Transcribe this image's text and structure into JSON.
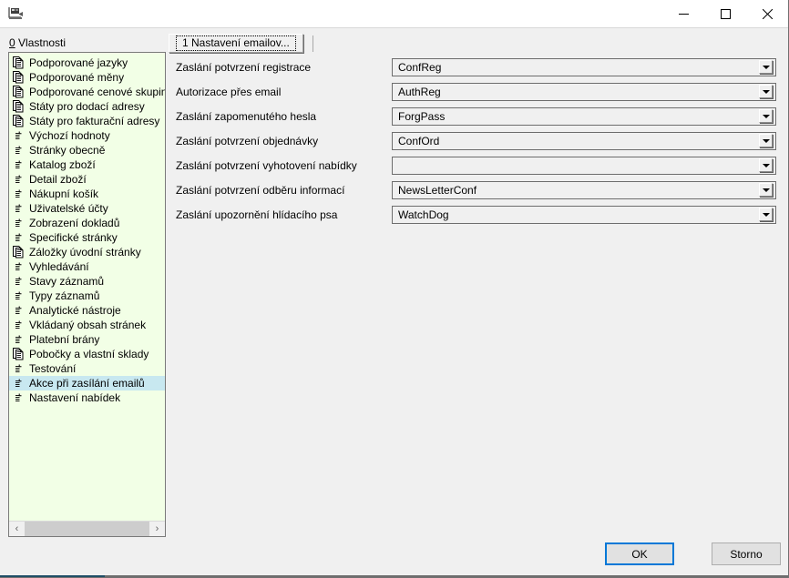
{
  "window": {
    "icon_name": "app-icon",
    "title": "",
    "controls": [
      {
        "name": "minimize-button",
        "glyph": "minimize-icon"
      },
      {
        "name": "maximize-button",
        "glyph": "maximize-icon"
      },
      {
        "name": "close-button",
        "glyph": "close-icon"
      }
    ]
  },
  "sidebar": {
    "label_accesskey": "0",
    "label_text": " Vlastnosti",
    "selected_index": 22,
    "items": [
      {
        "label": "Podporované jazyky",
        "icon": "multi-document-icon"
      },
      {
        "label": "Podporované měny",
        "icon": "multi-document-icon"
      },
      {
        "label": "Podporované cenové skupiny",
        "icon": "multi-document-icon"
      },
      {
        "label": "Státy pro dodací adresy",
        "icon": "multi-document-icon"
      },
      {
        "label": "Státy pro fakturační adresy",
        "icon": "multi-document-icon"
      },
      {
        "label": "Výchozí hodnoty",
        "icon": "document-icon"
      },
      {
        "label": "Stránky obecně",
        "icon": "document-icon"
      },
      {
        "label": "Katalog zboží",
        "icon": "document-icon"
      },
      {
        "label": "Detail zboží",
        "icon": "document-icon"
      },
      {
        "label": "Nákupní košík",
        "icon": "document-icon"
      },
      {
        "label": "Uživatelské účty",
        "icon": "document-icon"
      },
      {
        "label": "Zobrazení dokladů",
        "icon": "document-icon"
      },
      {
        "label": "Specifické stránky",
        "icon": "document-icon"
      },
      {
        "label": "Záložky úvodní stránky",
        "icon": "multi-document-icon"
      },
      {
        "label": "Vyhledávání",
        "icon": "document-icon"
      },
      {
        "label": "Stavy záznamů",
        "icon": "document-icon"
      },
      {
        "label": "Typy záznamů",
        "icon": "document-icon"
      },
      {
        "label": "Analytické nástroje",
        "icon": "document-icon"
      },
      {
        "label": "Vkládaný obsah stránek",
        "icon": "document-icon"
      },
      {
        "label": "Platební brány",
        "icon": "document-icon"
      },
      {
        "label": "Pobočky a vlastní sklady",
        "icon": "multi-document-icon"
      },
      {
        "label": "Testování",
        "icon": "document-icon"
      },
      {
        "label": "Akce při zasílání emailů",
        "icon": "document-icon"
      },
      {
        "label": "Nastavení nabídek",
        "icon": "document-icon"
      }
    ],
    "scrollbar": {
      "left_arrow": "‹",
      "right_arrow": "›"
    }
  },
  "tabs": [
    {
      "label": "1 Nastavení emailov...",
      "active": true
    }
  ],
  "form": {
    "rows": [
      {
        "label": "Zaslání potvrzení registrace",
        "value": "ConfReg"
      },
      {
        "label": "Autorizace přes email",
        "value": "AuthReg"
      },
      {
        "label": "Zaslání zapomenutého hesla",
        "value": "ForgPass"
      },
      {
        "label": "Zaslání potvrzení objednávky",
        "value": "ConfOrd"
      },
      {
        "label": "Zaslání potvrzení vyhotovení nabídky",
        "value": ""
      },
      {
        "label": "Zaslání potvrzení odběru informací",
        "value": "NewsLetterConf"
      },
      {
        "label": "Zaslání upozornění hlídacího psa",
        "value": "WatchDog"
      }
    ]
  },
  "footer": {
    "ok_label": "OK",
    "cancel_label": "Storno"
  },
  "colors": {
    "list_background": "#f2ffe6",
    "selection": "#c8e8f0",
    "panel": "#f0f0f0",
    "focus_accent": "#0078d7",
    "border": "#6d6d6d"
  }
}
